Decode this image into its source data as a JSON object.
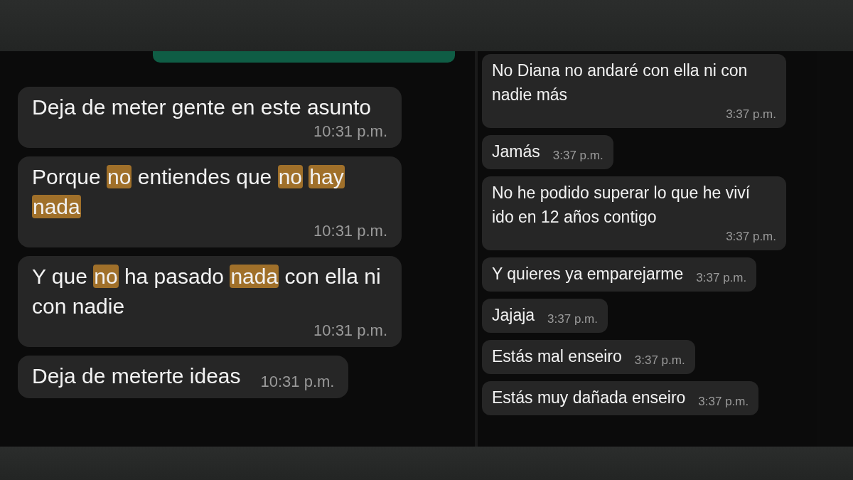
{
  "left_chat": {
    "messages": [
      {
        "parts": [
          {
            "text": "Deja de meter gente en este asunto",
            "highlighted": false
          }
        ],
        "time": "10:31 p.m."
      },
      {
        "parts": [
          {
            "text": "Porque ",
            "highlighted": false
          },
          {
            "text": "no",
            "highlighted": true
          },
          {
            "text": " entiendes que ",
            "highlighted": false
          },
          {
            "text": "no ",
            "highlighted": true
          },
          {
            "text": "hay ",
            "highlighted": true
          },
          {
            "text": "nada",
            "highlighted": true
          }
        ],
        "time": "10:31 p.m."
      },
      {
        "parts": [
          {
            "text": "Y que ",
            "highlighted": false
          },
          {
            "text": "no",
            "highlighted": true
          },
          {
            "text": " ha pasado ",
            "highlighted": false
          },
          {
            "text": "nada",
            "highlighted": true
          },
          {
            "text": " con ella ni con nadie",
            "highlighted": false
          }
        ],
        "time": "10:31 p.m."
      },
      {
        "parts": [
          {
            "text": "Deja de meterte ideas",
            "highlighted": false
          }
        ],
        "time": "10:31 p.m."
      }
    ]
  },
  "right_chat": {
    "messages": [
      {
        "parts": [
          {
            "text": "No Diana no andaré con ella ni con nadie más",
            "highlighted": false
          }
        ],
        "time": "3:37 p.m."
      },
      {
        "parts": [
          {
            "text": "Jamás",
            "highlighted": false
          }
        ],
        "time": "3:37 p.m."
      },
      {
        "parts": [
          {
            "text": "No he podido superar lo que he viví ido en 12 años contigo",
            "highlighted": false
          }
        ],
        "time": "3:37 p.m."
      },
      {
        "parts": [
          {
            "text": "Y quieres ya emparejarme",
            "highlighted": false
          }
        ],
        "time": "3:37 p.m."
      },
      {
        "parts": [
          {
            "text": "Jajaja",
            "highlighted": false
          }
        ],
        "time": "3:37 p.m."
      },
      {
        "parts": [
          {
            "text": "Estás mal enseiro",
            "highlighted": false
          }
        ],
        "time": "3:37 p.m."
      },
      {
        "parts": [
          {
            "text": "Estás muy dañada enseiro",
            "highlighted": false
          }
        ],
        "time": "3:37 p.m."
      }
    ]
  }
}
